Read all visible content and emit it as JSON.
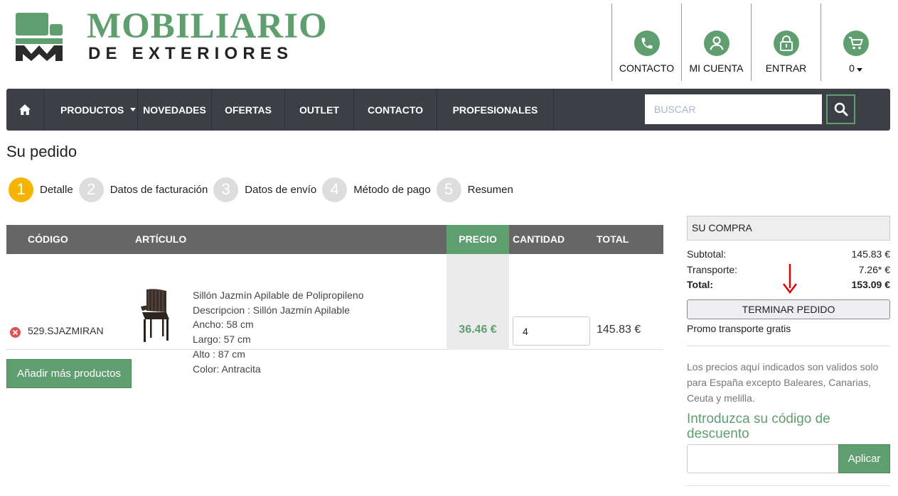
{
  "logo": {
    "title": "MOBILIARIO",
    "subtitle": "DE EXTERIORES"
  },
  "header_links": [
    {
      "label": "CONTACTO",
      "icon": "phone-icon"
    },
    {
      "label": "MI CUENTA",
      "icon": "user-icon"
    },
    {
      "label": "ENTRAR",
      "icon": "lock-icon"
    },
    {
      "label": "0",
      "icon": "cart-icon"
    }
  ],
  "nav": {
    "items": [
      "PRODUCTOS",
      "NOVEDADES",
      "OFERTAS",
      "OUTLET",
      "CONTACTO",
      "PROFESIONALES"
    ],
    "search_placeholder": "BUSCAR"
  },
  "page": {
    "title": "Su pedido"
  },
  "steps": [
    {
      "num": "1",
      "label": "Detalle",
      "active": true
    },
    {
      "num": "2",
      "label": "Datos de facturación"
    },
    {
      "num": "3",
      "label": "Datos de envío"
    },
    {
      "num": "4",
      "label": "Método de pago"
    },
    {
      "num": "5",
      "label": "Resumen"
    }
  ],
  "table": {
    "headers": {
      "codigo": "CÓDIGO",
      "articulo": "ARTÍCULO",
      "precio": "PRECIO",
      "cantidad": "CANTIDAD",
      "total": "TOTAL"
    },
    "row": {
      "codigo": "529.SJAZMIRAN",
      "desc_lines": [
        "Sillón Jazmín Apilable de Polipropileno",
        "Descripcion : Sillón Jazmín Apilable",
        "Ancho: 58 cm",
        "Largo: 57 cm",
        "Alto : 87 cm",
        "Color: Antracita"
      ],
      "precio": "36.46 €",
      "cantidad": "4",
      "total": "145.83 €"
    }
  },
  "add_button": "Añadir más productos",
  "summary": {
    "title": "SU COMPRA",
    "subtotal_label": "Subtotal:",
    "subtotal": "145.83 €",
    "transporte_label": "Transporte:",
    "transporte": "7.26* €",
    "total_label": "Total:",
    "total": "153.09 €",
    "button": "TERMINAR PEDIDO",
    "promo": "Promo transporte gratis",
    "note": "Los precios aquí indicados son validos solo para España excepto Baleares, Canarias, Ceuta y melilla.",
    "discount_title": "Introduzca su código de descuento",
    "discount_value": "",
    "apply_button": "Aplicar"
  },
  "colors": {
    "brand_green": "#5f9e6e",
    "nav_bg": "#3c3f46",
    "step_active": "#f4b400",
    "arrow_red": "#e00000"
  }
}
